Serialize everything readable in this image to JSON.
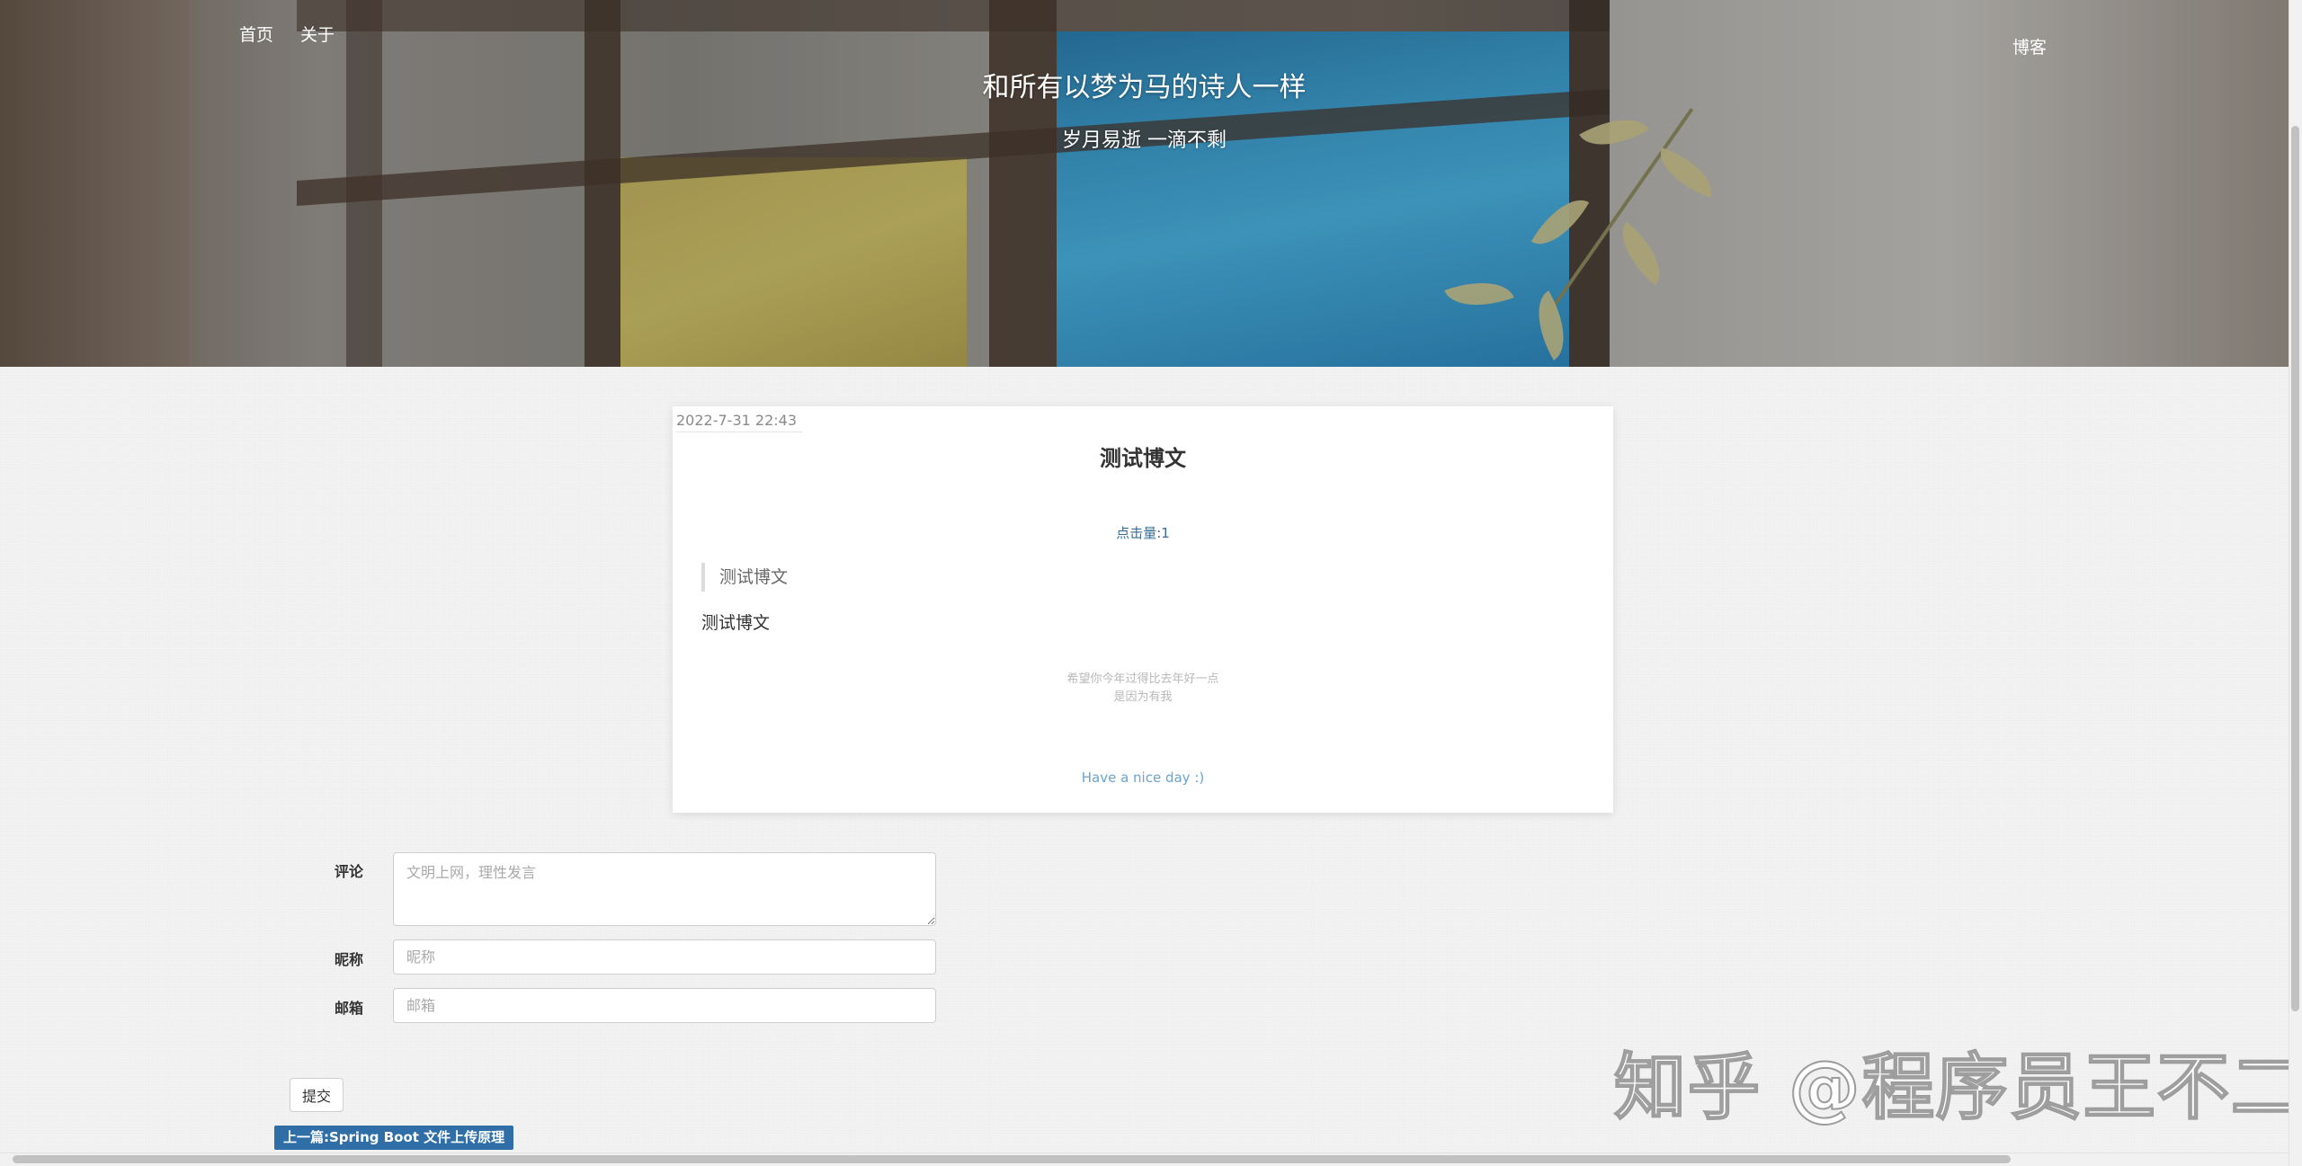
{
  "nav": {
    "home": "首页",
    "about": "关于",
    "blog": "博客"
  },
  "hero": {
    "title": "和所有以梦为马的诗人一样",
    "subtitle": "岁月易逝 一滴不剩"
  },
  "post": {
    "date": "2022-7-31 22:43",
    "title": "测试博文",
    "views": "点击量:1",
    "quote": "测试博文",
    "body": "测试博文",
    "motto_line1": "希望你今年过得比去年好一点",
    "motto_line2": "是因为有我",
    "footer": "Have a nice day :)"
  },
  "comment_form": {
    "comment_label": "评论",
    "comment_placeholder": "文明上网，理性发言",
    "nickname_label": "昵称",
    "nickname_placeholder": "昵称",
    "email_label": "邮箱",
    "email_placeholder": "邮箱",
    "submit_label": "提交"
  },
  "prev_post": "上一篇:Spring Boot 文件上传原理",
  "watermark": "知乎 @程序员王不二",
  "colors": {
    "accent": "#2f6ea6",
    "views_text": "#3a6c93",
    "footer_text": "#6aa4cf",
    "page_bg": "#f3f3f3"
  }
}
